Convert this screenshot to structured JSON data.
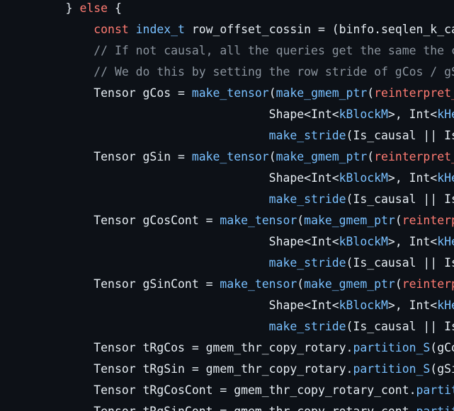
{
  "editor": {
    "lines": [
      {
        "indent": "        ",
        "tokens": [
          {
            "t": "} ",
            "c": "plain"
          },
          {
            "t": "else",
            "c": "kw"
          },
          {
            "t": " {",
            "c": "plain"
          }
        ]
      },
      {
        "indent": "            ",
        "tokens": [
          {
            "t": "const",
            "c": "kw"
          },
          {
            "t": " ",
            "c": "plain"
          },
          {
            "t": "index_t",
            "c": "type"
          },
          {
            "t": " row_offset_cossin = (binfo.seqlen_k_cac",
            "c": "plain"
          }
        ]
      },
      {
        "indent": "            ",
        "tokens": [
          {
            "t": "// If not causal, all the queries get the same the co",
            "c": "comment"
          }
        ]
      },
      {
        "indent": "            ",
        "tokens": [
          {
            "t": "// We do this by setting the row stride of gCos / gSi",
            "c": "comment"
          }
        ]
      },
      {
        "indent": "            ",
        "tokens": [
          {
            "t": "Tensor gCos = ",
            "c": "plain"
          },
          {
            "t": "make_tensor",
            "c": "fn"
          },
          {
            "t": "(",
            "c": "plain"
          },
          {
            "t": "make_gmem_ptr",
            "c": "fn"
          },
          {
            "t": "(",
            "c": "plain"
          },
          {
            "t": "reinterpret_c",
            "c": "cast"
          }
        ]
      },
      {
        "indent": "                                     ",
        "tokens": [
          {
            "t": "Shape<Int<",
            "c": "plain"
          },
          {
            "t": "kBlockM",
            "c": "const"
          },
          {
            "t": ">, Int<",
            "c": "plain"
          },
          {
            "t": "kHe",
            "c": "const"
          }
        ]
      },
      {
        "indent": "                                     ",
        "tokens": [
          {
            "t": "make_stride",
            "c": "fn"
          },
          {
            "t": "(Is_causal || Is",
            "c": "plain"
          }
        ]
      },
      {
        "indent": "            ",
        "tokens": [
          {
            "t": "Tensor gSin = ",
            "c": "plain"
          },
          {
            "t": "make_tensor",
            "c": "fn"
          },
          {
            "t": "(",
            "c": "plain"
          },
          {
            "t": "make_gmem_ptr",
            "c": "fn"
          },
          {
            "t": "(",
            "c": "plain"
          },
          {
            "t": "reinterpret_c",
            "c": "cast"
          }
        ]
      },
      {
        "indent": "                                     ",
        "tokens": [
          {
            "t": "Shape<Int<",
            "c": "plain"
          },
          {
            "t": "kBlockM",
            "c": "const"
          },
          {
            "t": ">, Int<",
            "c": "plain"
          },
          {
            "t": "kHe",
            "c": "const"
          }
        ]
      },
      {
        "indent": "                                     ",
        "tokens": [
          {
            "t": "make_stride",
            "c": "fn"
          },
          {
            "t": "(Is_causal || Is",
            "c": "plain"
          }
        ]
      },
      {
        "indent": "            ",
        "tokens": [
          {
            "t": "Tensor gCosCont = ",
            "c": "plain"
          },
          {
            "t": "make_tensor",
            "c": "fn"
          },
          {
            "t": "(",
            "c": "plain"
          },
          {
            "t": "make_gmem_ptr",
            "c": "fn"
          },
          {
            "t": "(",
            "c": "plain"
          },
          {
            "t": "reinterpr",
            "c": "cast"
          }
        ]
      },
      {
        "indent": "                                     ",
        "tokens": [
          {
            "t": "Shape<Int<",
            "c": "plain"
          },
          {
            "t": "kBlockM",
            "c": "const"
          },
          {
            "t": ">, Int<",
            "c": "plain"
          },
          {
            "t": "kHe",
            "c": "const"
          }
        ]
      },
      {
        "indent": "                                     ",
        "tokens": [
          {
            "t": "make_stride",
            "c": "fn"
          },
          {
            "t": "(Is_causal || Is",
            "c": "plain"
          }
        ]
      },
      {
        "indent": "            ",
        "tokens": [
          {
            "t": "Tensor gSinCont = ",
            "c": "plain"
          },
          {
            "t": "make_tensor",
            "c": "fn"
          },
          {
            "t": "(",
            "c": "plain"
          },
          {
            "t": "make_gmem_ptr",
            "c": "fn"
          },
          {
            "t": "(",
            "c": "plain"
          },
          {
            "t": "reinterpr",
            "c": "cast"
          }
        ]
      },
      {
        "indent": "                                     ",
        "tokens": [
          {
            "t": "Shape<Int<",
            "c": "plain"
          },
          {
            "t": "kBlockM",
            "c": "const"
          },
          {
            "t": ">, Int<",
            "c": "plain"
          },
          {
            "t": "kHe",
            "c": "const"
          }
        ]
      },
      {
        "indent": "                                     ",
        "tokens": [
          {
            "t": "make_stride",
            "c": "fn"
          },
          {
            "t": "(Is_causal || Is",
            "c": "plain"
          }
        ]
      },
      {
        "indent": "            ",
        "tokens": [
          {
            "t": "Tensor tRgCos = gmem_thr_copy_rotary.",
            "c": "plain"
          },
          {
            "t": "partition_S",
            "c": "fn"
          },
          {
            "t": "(gCos",
            "c": "plain"
          }
        ]
      },
      {
        "indent": "            ",
        "tokens": [
          {
            "t": "Tensor tRgSin = gmem_thr_copy_rotary.",
            "c": "plain"
          },
          {
            "t": "partition_S",
            "c": "fn"
          },
          {
            "t": "(gSin",
            "c": "plain"
          }
        ]
      },
      {
        "indent": "            ",
        "tokens": [
          {
            "t": "Tensor tRgCosCont = gmem_thr_copy_rotary_cont.",
            "c": "plain"
          },
          {
            "t": "partiti",
            "c": "fn"
          }
        ]
      },
      {
        "indent": "            ",
        "tokens": [
          {
            "t": "Tensor tRgSinCont = gmem_thr_copy_rotary_cont.",
            "c": "plain"
          },
          {
            "t": "partiti",
            "c": "fn"
          }
        ]
      }
    ]
  }
}
